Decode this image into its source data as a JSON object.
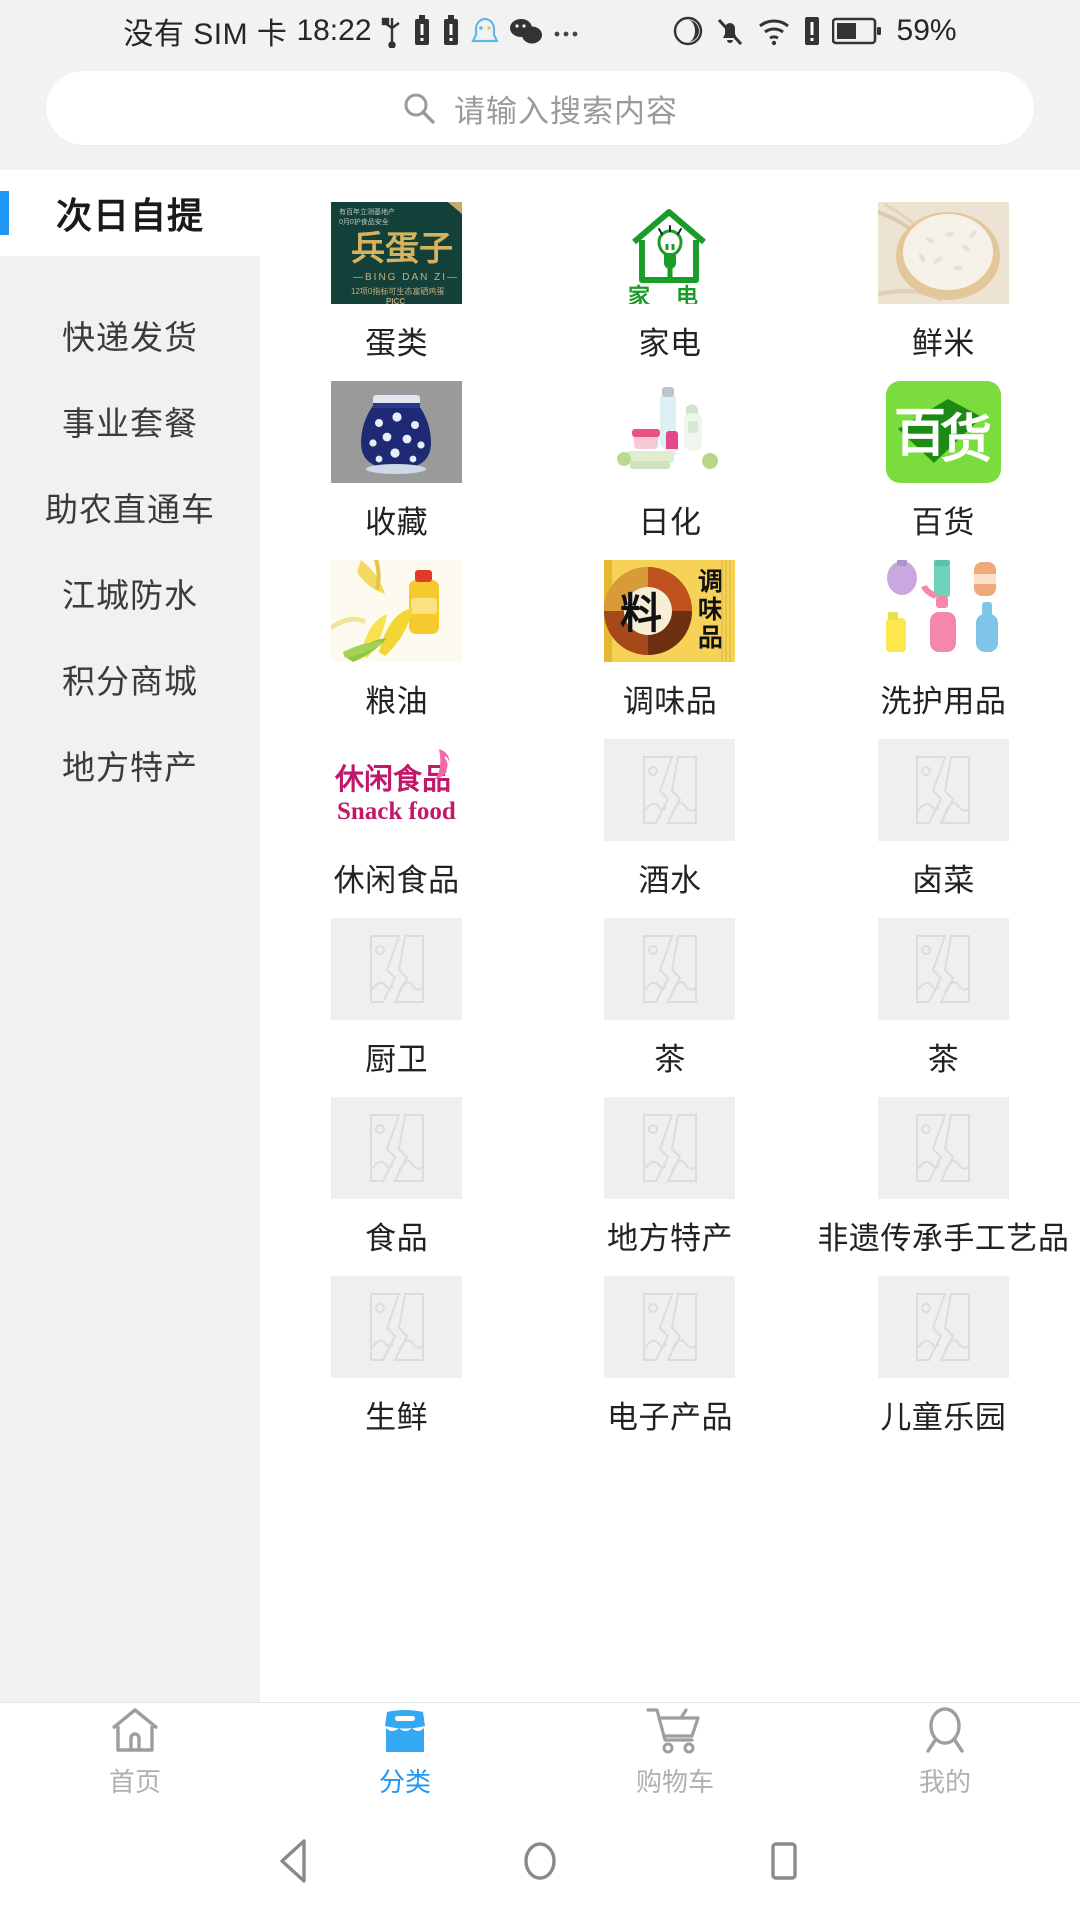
{
  "status_bar": {
    "carrier": "没有 SIM 卡",
    "time": "18:22",
    "battery_percent": "59%",
    "icons_left": [
      "usb-icon",
      "battery-alert-icon",
      "battery-alert-icon-2",
      "qq-icon",
      "wechat-icon",
      "more-icon"
    ],
    "icons_right": [
      "eye-care-icon",
      "silent-bell-icon",
      "wifi-icon",
      "sim-alert-icon",
      "battery-icon"
    ]
  },
  "search": {
    "placeholder": "请输入搜索内容",
    "icon": "search-icon"
  },
  "sidebar": {
    "items": [
      {
        "label": "次日自提",
        "active": true
      },
      {
        "label": "快递发货",
        "active": false
      },
      {
        "label": "事业套餐",
        "active": false
      },
      {
        "label": "助农直通车",
        "active": false
      },
      {
        "label": "江城防水",
        "active": false
      },
      {
        "label": "积分商城",
        "active": false
      },
      {
        "label": "地方特产",
        "active": false
      }
    ],
    "active_accent": "#2196f3"
  },
  "categories": [
    {
      "label": "蛋类",
      "image": "egg-product-poster"
    },
    {
      "label": "家电",
      "image": "home-appliance-logo"
    },
    {
      "label": "鲜米",
      "image": "fresh-rice-basket"
    },
    {
      "label": "收藏",
      "image": "blue-porcelain-jar"
    },
    {
      "label": "日化",
      "image": "daily-chemical-bottles"
    },
    {
      "label": "百货",
      "image": "general-merchandise-logo"
    },
    {
      "label": "粮油",
      "image": "grain-oil-corn"
    },
    {
      "label": "调味品",
      "image": "seasoning-poster"
    },
    {
      "label": "洗护用品",
      "image": "wash-care-bottles"
    },
    {
      "label": "休闲食品",
      "image": "snack-food-logo"
    },
    {
      "label": "酒水",
      "image": "placeholder-image"
    },
    {
      "label": "卤菜",
      "image": "placeholder-image"
    },
    {
      "label": "厨卫",
      "image": "placeholder-image"
    },
    {
      "label": "茶",
      "image": "placeholder-image"
    },
    {
      "label": "茶",
      "image": "placeholder-image"
    },
    {
      "label": "食品",
      "image": "placeholder-image"
    },
    {
      "label": "地方特产",
      "image": "placeholder-image"
    },
    {
      "label": "非遗传承手工艺品",
      "image": "placeholder-image"
    },
    {
      "label": "生鲜",
      "image": "placeholder-image"
    },
    {
      "label": "电子产品",
      "image": "placeholder-image"
    },
    {
      "label": "儿童乐园",
      "image": "placeholder-image"
    }
  ],
  "tabbar": {
    "accent": "#2196f3",
    "inactive": "#b0b0b0",
    "items": [
      {
        "label": "首页",
        "icon": "home-icon",
        "active": false
      },
      {
        "label": "分类",
        "icon": "category-icon",
        "active": true
      },
      {
        "label": "购物车",
        "icon": "cart-icon",
        "active": false
      },
      {
        "label": "我的",
        "icon": "profile-icon",
        "active": false
      }
    ]
  },
  "android_nav": {
    "back": "back-triangle-icon",
    "home": "home-circle-icon",
    "recents": "recents-square-icon"
  }
}
